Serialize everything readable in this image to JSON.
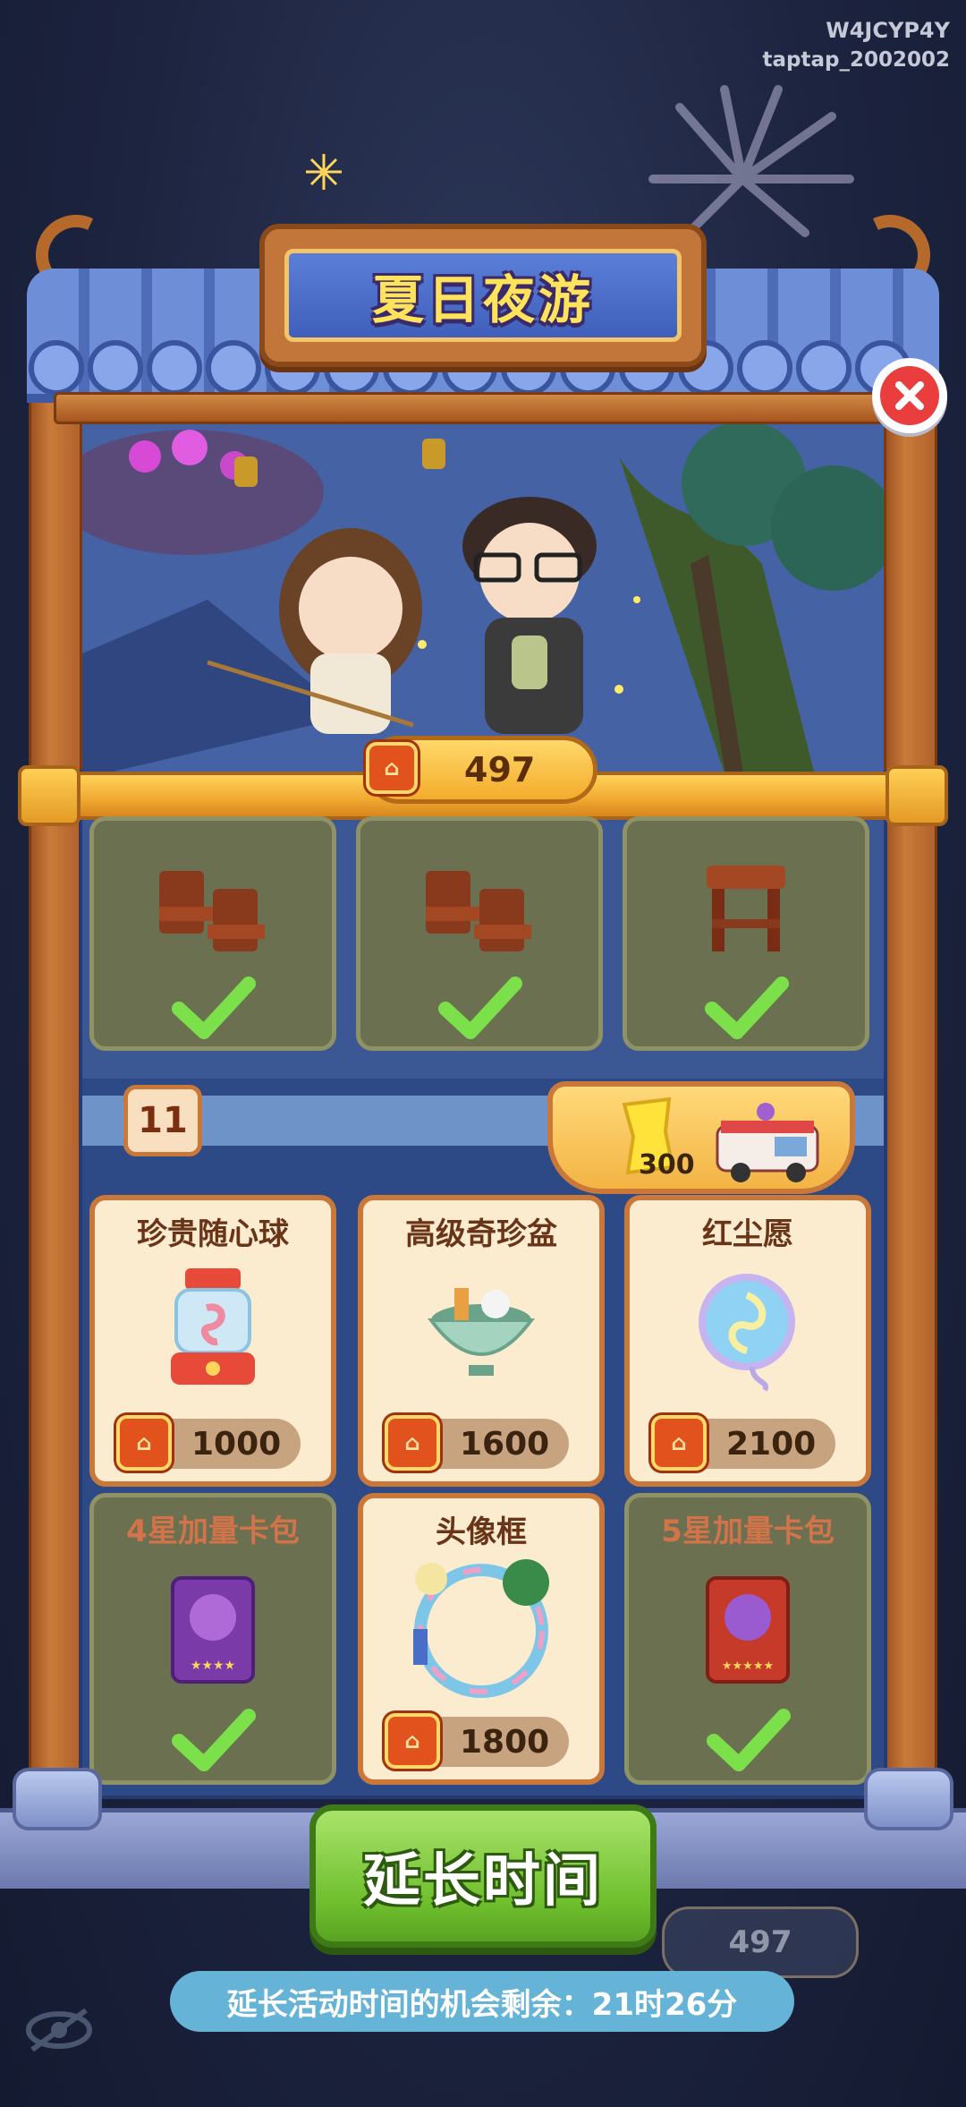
{
  "watermark": {
    "line1": "W4JCYP4Y",
    "line2": "taptap_2002002"
  },
  "header": {
    "title": "夏日夜游",
    "close_icon": "close-icon"
  },
  "currency": {
    "icon": "token-coin-icon",
    "amount": "497"
  },
  "owned_row": [
    {
      "name": "wooden-chairs",
      "owned": true
    },
    {
      "name": "wooden-chairs",
      "owned": true
    },
    {
      "name": "wooden-stool",
      "owned": true
    }
  ],
  "tier": {
    "level": "11",
    "reward_amount": "300",
    "reward_icons": [
      "gold-ticket-icon",
      "food-truck-icon"
    ]
  },
  "shop_items": [
    {
      "label": "珍贵随心球",
      "price": "1000",
      "owned": false
    },
    {
      "label": "高级奇珍盆",
      "price": "1600",
      "owned": false
    },
    {
      "label": "红尘愿",
      "price": "2100",
      "owned": false
    },
    {
      "label": "4星加量卡包",
      "price": "",
      "owned": true
    },
    {
      "label": "头像框",
      "price": "1800",
      "owned": false
    },
    {
      "label": "5星加量卡包",
      "price": "",
      "owned": true
    }
  ],
  "footer": {
    "extend_button": "延长时间",
    "hint": "延长活动时间的机会剩余：21时26分",
    "background_counter": "497"
  },
  "colors": {
    "accent": "#f3ac2c",
    "confirm_green": "#6fbf2e",
    "close_red": "#ea3d3d",
    "check_green": "#7be04a"
  }
}
